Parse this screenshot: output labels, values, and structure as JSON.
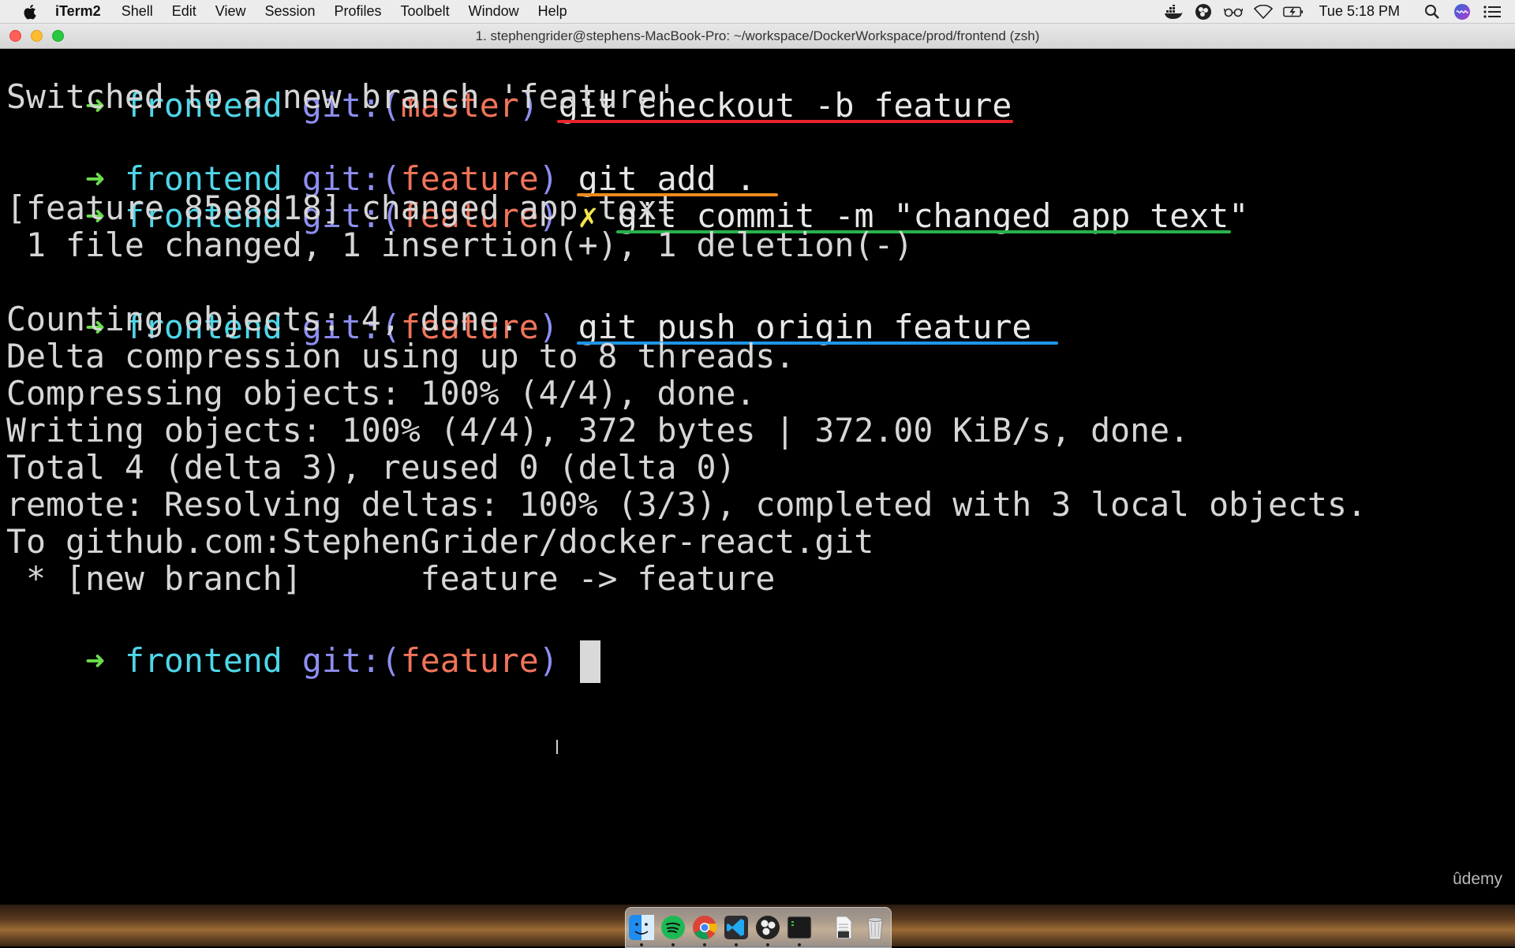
{
  "menubar": {
    "app_name": "iTerm2",
    "menus": [
      "Shell",
      "Edit",
      "View",
      "Session",
      "Profiles",
      "Toolbelt",
      "Window",
      "Help"
    ],
    "clock": "Tue 5:18 PM",
    "status_icons": [
      "docker-icon",
      "obs-icon",
      "glasses-icon",
      "wifi-icon",
      "battery-icon"
    ]
  },
  "window": {
    "title": "1. stephengrider@stephens-MacBook-Pro: ~/workspace/DockerWorkspace/prod/frontend (zsh)"
  },
  "terminal": {
    "prompt": {
      "arrow": "➜",
      "dir": "frontend",
      "git_open": "git:(",
      "git_close": ")",
      "dirty_mark": "✗"
    },
    "lines": [
      {
        "kind": "prompt",
        "branch": "master",
        "command": "git checkout -b feature"
      },
      {
        "kind": "output",
        "text": "Switched to a new branch 'feature'"
      },
      {
        "kind": "prompt",
        "branch": "feature",
        "command": "git add ."
      },
      {
        "kind": "prompt",
        "branch": "feature",
        "dirty": true,
        "command": "git commit -m \"changed app text\""
      },
      {
        "kind": "output",
        "text": "[feature 85e8d18] changed app text"
      },
      {
        "kind": "output",
        "text": " 1 file changed, 1 insertion(+), 1 deletion(-)"
      },
      {
        "kind": "prompt",
        "branch": "feature",
        "command": "git push origin feature"
      },
      {
        "kind": "output",
        "text": "Counting objects: 4, done."
      },
      {
        "kind": "output",
        "text": "Delta compression using up to 8 threads."
      },
      {
        "kind": "output",
        "text": "Compressing objects: 100% (4/4), done."
      },
      {
        "kind": "output",
        "text": "Writing objects: 100% (4/4), 372 bytes | 372.00 KiB/s, done."
      },
      {
        "kind": "output",
        "text": "Total 4 (delta 3), reused 0 (delta 0)"
      },
      {
        "kind": "output",
        "text": "remote: Resolving deltas: 100% (3/3), completed with 3 local objects."
      },
      {
        "kind": "output",
        "text": "To github.com:StephenGrider/docker-react.git"
      },
      {
        "kind": "output",
        "text": " * [new branch]      feature -> feature"
      },
      {
        "kind": "prompt",
        "branch": "feature",
        "command": ""
      }
    ]
  },
  "watermark": "ûdemy",
  "dock": {
    "apps": [
      "finder-icon",
      "spotify-icon",
      "chrome-icon",
      "vscode-icon",
      "obs-icon",
      "terminal-icon",
      "document-icon",
      "trash-icon"
    ]
  },
  "colors": {
    "underline_checkout": "#e8232a",
    "underline_add": "#f08a1c",
    "underline_commit": "#28b24b",
    "underline_push": "#1f95e6"
  }
}
